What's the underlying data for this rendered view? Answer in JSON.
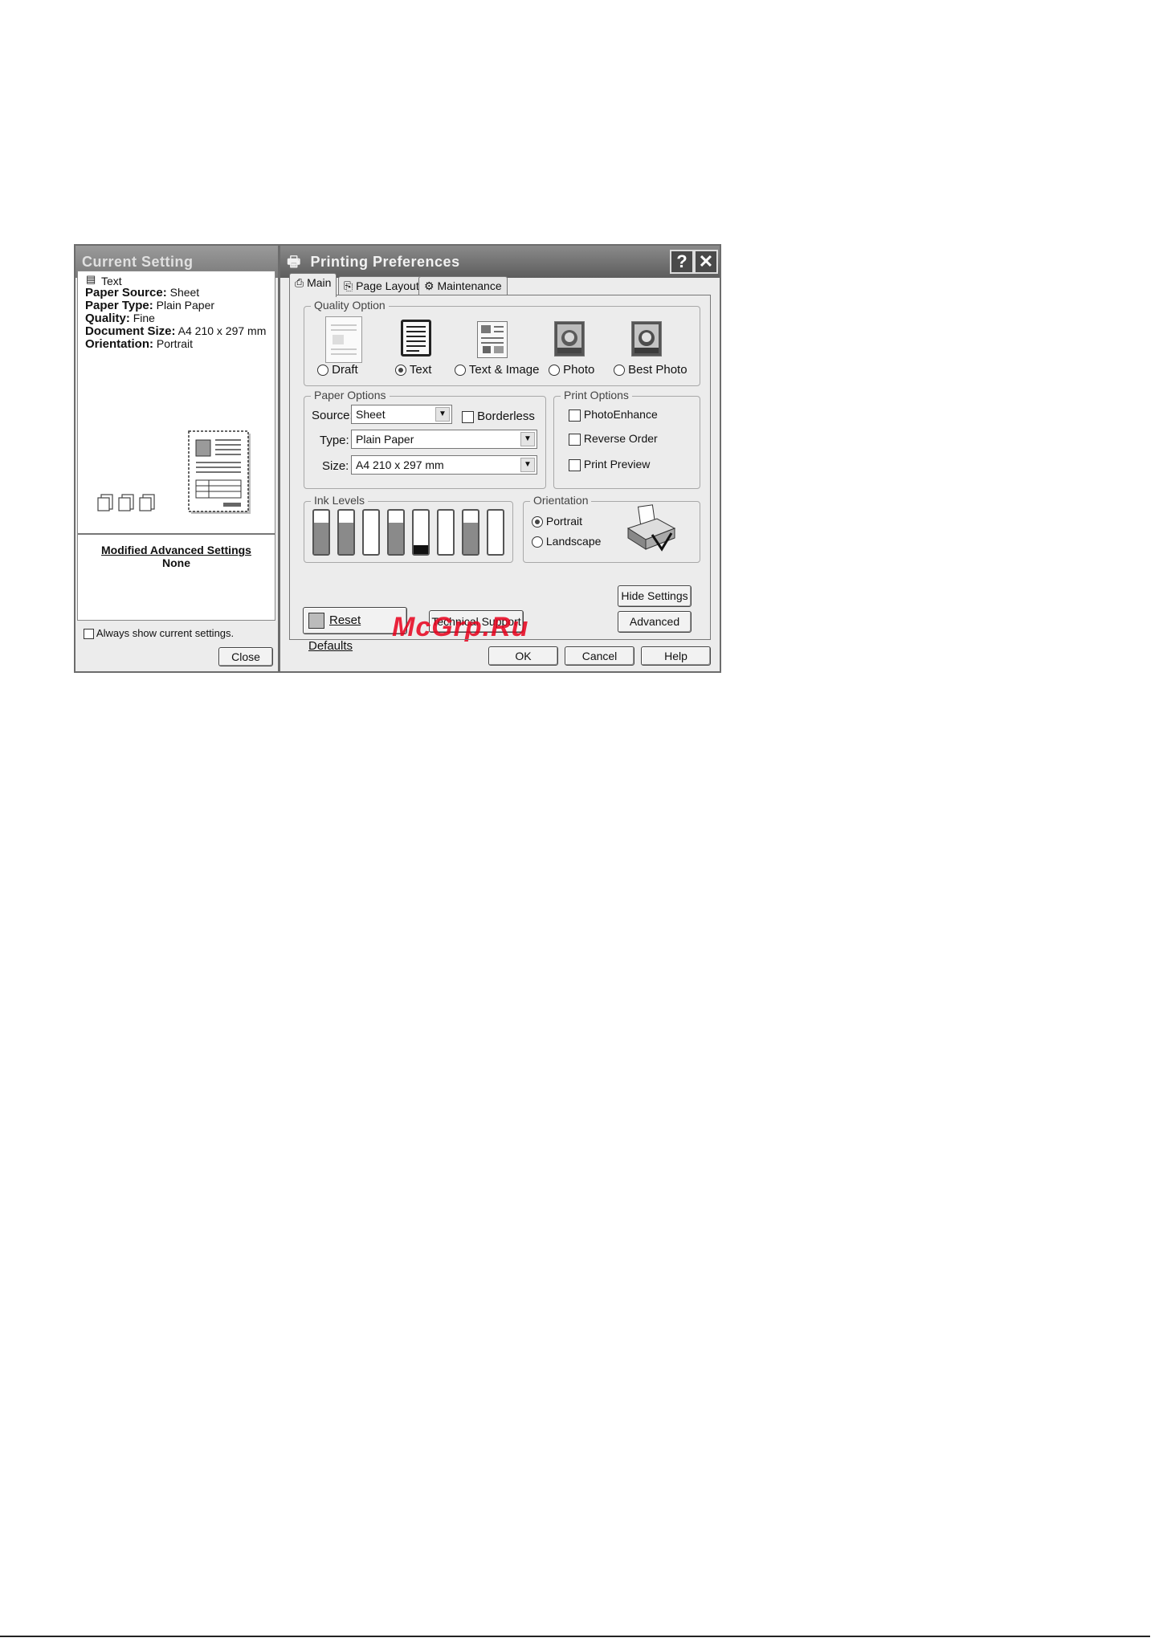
{
  "current_setting": {
    "title": "Current Setting",
    "quality_line": "Text",
    "lines": [
      {
        "label": "Paper Source:",
        "value": "Sheet"
      },
      {
        "label": "Paper Type:",
        "value": "Plain Paper"
      },
      {
        "label": "Quality:",
        "value": "Fine"
      },
      {
        "label": "Document Size:",
        "value": "A4 210 x 297 mm"
      },
      {
        "label": "Orientation:",
        "value": "Portrait"
      }
    ],
    "modified_title": "Modified Advanced Settings",
    "modified_value": "None",
    "always_show_label": "Always show current settings.",
    "close_label": "Close"
  },
  "printing_preferences": {
    "title": "Printing Preferences",
    "help_glyph": "?",
    "close_glyph": "✕",
    "tabs": [
      {
        "label": "Main",
        "icon": "printer-icon",
        "active": true
      },
      {
        "label": "Page Layout",
        "icon": "page-layout-icon",
        "active": false
      },
      {
        "label": "Maintenance",
        "icon": "maintenance-icon",
        "active": false
      }
    ],
    "quality_option": {
      "label": "Quality Option",
      "options": [
        {
          "label": "Draft",
          "selected": false
        },
        {
          "label": "Text",
          "selected": true
        },
        {
          "label": "Text & Image",
          "selected": false
        },
        {
          "label": "Photo",
          "selected": false
        },
        {
          "label": "Best Photo",
          "selected": false
        }
      ]
    },
    "paper_options": {
      "label": "Paper Options",
      "source_label": "Source:",
      "source_value": "Sheet",
      "borderless_label": "Borderless",
      "type_label": "Type:",
      "type_value": "Plain Paper",
      "size_label": "Size:",
      "size_value": "A4 210 x 297 mm"
    },
    "print_options": {
      "label": "Print Options",
      "items": [
        "PhotoEnhance",
        "Reverse Order",
        "Print Preview"
      ]
    },
    "ink_levels": {
      "label": "Ink Levels",
      "levels": [
        0.72,
        0.72,
        0.0,
        0.72,
        0.2,
        0.0,
        0.72,
        0.0
      ]
    },
    "orientation": {
      "label": "Orientation",
      "portrait_label": "Portrait",
      "landscape_label": "Landscape",
      "selected": "portrait"
    },
    "buttons": {
      "reset_defaults": "Reset Defaults",
      "technical_support": "Technical Support",
      "hide_settings": "Hide Settings",
      "advanced": "Advanced",
      "ok": "OK",
      "cancel": "Cancel",
      "help": "Help"
    }
  },
  "watermark": "McGrp.Ru"
}
